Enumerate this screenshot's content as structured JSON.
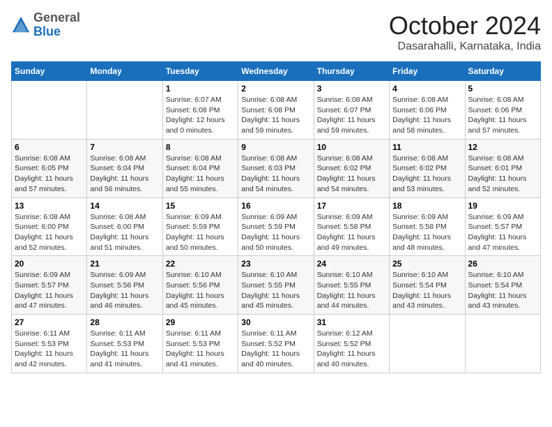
{
  "header": {
    "logo": {
      "line1": "General",
      "line2": "Blue"
    },
    "title": "October 2024",
    "subtitle": "Dasarahalli, Karnataka, India"
  },
  "calendar": {
    "days_of_week": [
      "Sunday",
      "Monday",
      "Tuesday",
      "Wednesday",
      "Thursday",
      "Friday",
      "Saturday"
    ],
    "weeks": [
      [
        {
          "day": "",
          "detail": ""
        },
        {
          "day": "",
          "detail": ""
        },
        {
          "day": "1",
          "detail": "Sunrise: 6:07 AM\nSunset: 6:08 PM\nDaylight: 12 hours\nand 0 minutes."
        },
        {
          "day": "2",
          "detail": "Sunrise: 6:08 AM\nSunset: 6:08 PM\nDaylight: 11 hours\nand 59 minutes."
        },
        {
          "day": "3",
          "detail": "Sunrise: 6:08 AM\nSunset: 6:07 PM\nDaylight: 11 hours\nand 59 minutes."
        },
        {
          "day": "4",
          "detail": "Sunrise: 6:08 AM\nSunset: 6:06 PM\nDaylight: 11 hours\nand 58 minutes."
        },
        {
          "day": "5",
          "detail": "Sunrise: 6:08 AM\nSunset: 6:06 PM\nDaylight: 11 hours\nand 57 minutes."
        }
      ],
      [
        {
          "day": "6",
          "detail": "Sunrise: 6:08 AM\nSunset: 6:05 PM\nDaylight: 11 hours\nand 57 minutes."
        },
        {
          "day": "7",
          "detail": "Sunrise: 6:08 AM\nSunset: 6:04 PM\nDaylight: 11 hours\nand 56 minutes."
        },
        {
          "day": "8",
          "detail": "Sunrise: 6:08 AM\nSunset: 6:04 PM\nDaylight: 11 hours\nand 55 minutes."
        },
        {
          "day": "9",
          "detail": "Sunrise: 6:08 AM\nSunset: 6:03 PM\nDaylight: 11 hours\nand 54 minutes."
        },
        {
          "day": "10",
          "detail": "Sunrise: 6:08 AM\nSunset: 6:02 PM\nDaylight: 11 hours\nand 54 minutes."
        },
        {
          "day": "11",
          "detail": "Sunrise: 6:08 AM\nSunset: 6:02 PM\nDaylight: 11 hours\nand 53 minutes."
        },
        {
          "day": "12",
          "detail": "Sunrise: 6:08 AM\nSunset: 6:01 PM\nDaylight: 11 hours\nand 52 minutes."
        }
      ],
      [
        {
          "day": "13",
          "detail": "Sunrise: 6:08 AM\nSunset: 6:00 PM\nDaylight: 11 hours\nand 52 minutes."
        },
        {
          "day": "14",
          "detail": "Sunrise: 6:08 AM\nSunset: 6:00 PM\nDaylight: 11 hours\nand 51 minutes."
        },
        {
          "day": "15",
          "detail": "Sunrise: 6:09 AM\nSunset: 5:59 PM\nDaylight: 11 hours\nand 50 minutes."
        },
        {
          "day": "16",
          "detail": "Sunrise: 6:09 AM\nSunset: 5:59 PM\nDaylight: 11 hours\nand 50 minutes."
        },
        {
          "day": "17",
          "detail": "Sunrise: 6:09 AM\nSunset: 5:58 PM\nDaylight: 11 hours\nand 49 minutes."
        },
        {
          "day": "18",
          "detail": "Sunrise: 6:09 AM\nSunset: 5:58 PM\nDaylight: 11 hours\nand 48 minutes."
        },
        {
          "day": "19",
          "detail": "Sunrise: 6:09 AM\nSunset: 5:57 PM\nDaylight: 11 hours\nand 47 minutes."
        }
      ],
      [
        {
          "day": "20",
          "detail": "Sunrise: 6:09 AM\nSunset: 5:57 PM\nDaylight: 11 hours\nand 47 minutes."
        },
        {
          "day": "21",
          "detail": "Sunrise: 6:09 AM\nSunset: 5:56 PM\nDaylight: 11 hours\nand 46 minutes."
        },
        {
          "day": "22",
          "detail": "Sunrise: 6:10 AM\nSunset: 5:56 PM\nDaylight: 11 hours\nand 45 minutes."
        },
        {
          "day": "23",
          "detail": "Sunrise: 6:10 AM\nSunset: 5:55 PM\nDaylight: 11 hours\nand 45 minutes."
        },
        {
          "day": "24",
          "detail": "Sunrise: 6:10 AM\nSunset: 5:55 PM\nDaylight: 11 hours\nand 44 minutes."
        },
        {
          "day": "25",
          "detail": "Sunrise: 6:10 AM\nSunset: 5:54 PM\nDaylight: 11 hours\nand 43 minutes."
        },
        {
          "day": "26",
          "detail": "Sunrise: 6:10 AM\nSunset: 5:54 PM\nDaylight: 11 hours\nand 43 minutes."
        }
      ],
      [
        {
          "day": "27",
          "detail": "Sunrise: 6:11 AM\nSunset: 5:53 PM\nDaylight: 11 hours\nand 42 minutes."
        },
        {
          "day": "28",
          "detail": "Sunrise: 6:11 AM\nSunset: 5:53 PM\nDaylight: 11 hours\nand 41 minutes."
        },
        {
          "day": "29",
          "detail": "Sunrise: 6:11 AM\nSunset: 5:53 PM\nDaylight: 11 hours\nand 41 minutes."
        },
        {
          "day": "30",
          "detail": "Sunrise: 6:11 AM\nSunset: 5:52 PM\nDaylight: 11 hours\nand 40 minutes."
        },
        {
          "day": "31",
          "detail": "Sunrise: 6:12 AM\nSunset: 5:52 PM\nDaylight: 11 hours\nand 40 minutes."
        },
        {
          "day": "",
          "detail": ""
        },
        {
          "day": "",
          "detail": ""
        }
      ]
    ]
  }
}
